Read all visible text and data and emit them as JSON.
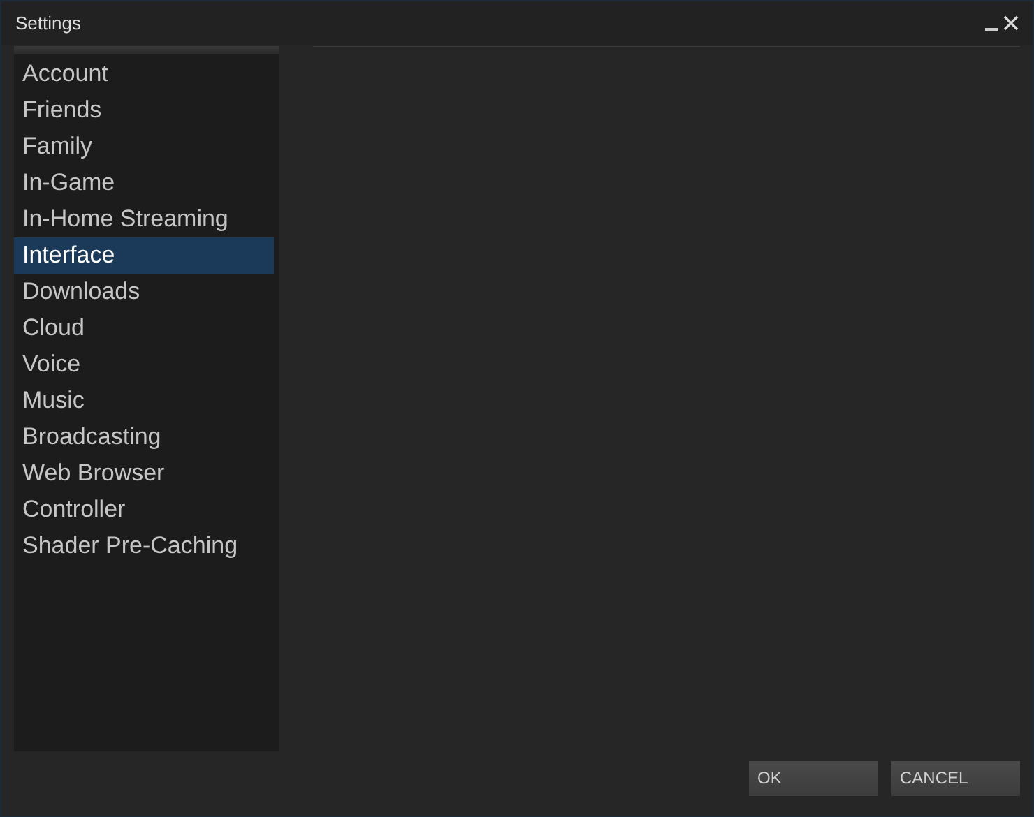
{
  "window": {
    "title": "Settings"
  },
  "sidebar": {
    "items": [
      {
        "label": "Account",
        "selected": false
      },
      {
        "label": "Friends",
        "selected": false
      },
      {
        "label": "Family",
        "selected": false
      },
      {
        "label": "In-Game",
        "selected": false
      },
      {
        "label": "In-Home Streaming",
        "selected": false
      },
      {
        "label": "Interface",
        "selected": true
      },
      {
        "label": "Downloads",
        "selected": false
      },
      {
        "label": "Cloud",
        "selected": false
      },
      {
        "label": "Voice",
        "selected": false
      },
      {
        "label": "Music",
        "selected": false
      },
      {
        "label": "Broadcasting",
        "selected": false
      },
      {
        "label": "Web Browser",
        "selected": false
      },
      {
        "label": "Controller",
        "selected": false
      },
      {
        "label": "Shader Pre-Caching",
        "selected": false
      }
    ]
  },
  "buttons": [
    "OK",
    "CANCEL"
  ]
}
